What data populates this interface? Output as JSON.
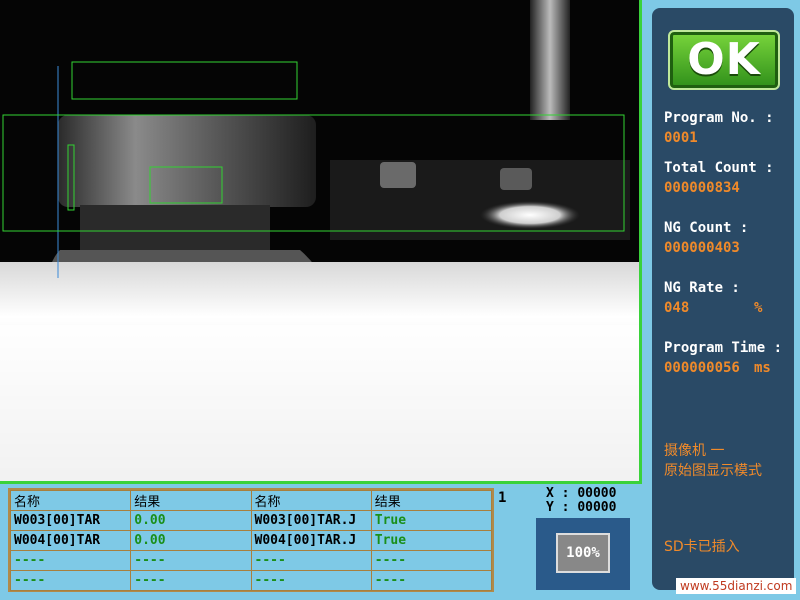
{
  "status": {
    "result": "OK",
    "color": "#3aa52a"
  },
  "panel": {
    "program_no_label": "Program No. :",
    "program_no": "0001",
    "total_count_label": "Total Count :",
    "total_count": "000000834",
    "ng_count_label": "NG Count :",
    "ng_count": "000000403",
    "ng_rate_label": "NG Rate :",
    "ng_rate": "048",
    "ng_rate_unit": "%",
    "program_time_label": "Program Time :",
    "program_time": "000000056",
    "program_time_unit": "ms",
    "camera_line1": "摄像机 一",
    "camera_line2": "原始图显示模式",
    "sd_status": "SD卡已插入"
  },
  "results": {
    "headers": [
      "名称",
      "结果",
      "名称",
      "结果"
    ],
    "rows": [
      [
        "W003[00]TAR",
        "0.00",
        "W003[00]TAR.J",
        "True"
      ],
      [
        "W004[00]TAR",
        "0.00",
        "W004[00]TAR.J",
        "True"
      ],
      [
        "----",
        "----",
        "----",
        "----"
      ],
      [
        "----",
        "----",
        "----",
        "----"
      ]
    ]
  },
  "row_index": "1",
  "coords": {
    "x_label": "X :",
    "x": "00000",
    "y_label": "Y :",
    "y": "00000"
  },
  "zoom": "100%",
  "watermark": "www.55dianzi.com",
  "colors": {
    "roi_green": "#32d232",
    "roi_blue": "#3a8ad8",
    "value_orange": "#f08a2a",
    "panel_bg": "#2a4a66"
  }
}
